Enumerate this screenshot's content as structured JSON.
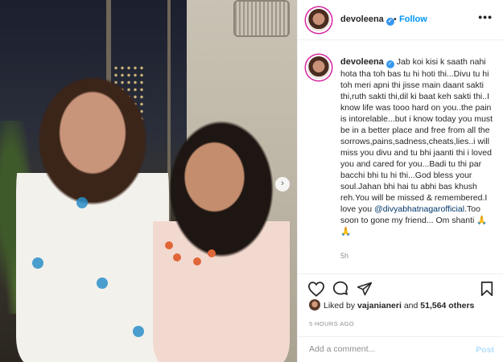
{
  "post": {
    "username": "devoleena",
    "follow_label": "Follow",
    "separator": "•",
    "more_label": "•••",
    "next_label": "›",
    "caption_parts": {
      "text1": "Jab koi kisi k saath nahi hota tha toh bas tu hi hoti thi...Divu tu hi toh meri apni thi jisse main daant sakti thi,ruth sakti thi,dil ki baat keh sakti thi..I know life was tooo hard on you..the pain is intorelable...but i know today you must be in a better place and free from all the sorrows,pains,sadness,cheats,lies..i will miss you divu and tu bhi jaanti thi i loved you and cared for you...Badi tu thi par bacchi bhi tu hi thi...God bless your soul.Jahan bhi hai tu abhi bas khush reh.You will be missed & remembered.I love you ",
      "mention": "@divyabhatnagarofficial",
      "text2": ".Too soon to gone my friend... Om shanti 🙏🙏"
    },
    "caption_time": "5h",
    "likes": {
      "prefix": "Liked by ",
      "liker": "vajanianeri",
      "middle": " and ",
      "count": "51,564 others"
    },
    "posted_ago": "5 HOURS AGO",
    "comment_placeholder": "Add a comment...",
    "post_label": "Post"
  },
  "icons": {
    "like": "heart-icon",
    "comment": "comment-icon",
    "share": "share-icon",
    "save": "bookmark-icon",
    "verified": "verified-badge-icon"
  },
  "colors": {
    "accent": "#0095f6",
    "verified": "#3897f0",
    "mention": "#00376b",
    "muted": "#8e8e8e",
    "post_disabled": "#b2dffc"
  }
}
